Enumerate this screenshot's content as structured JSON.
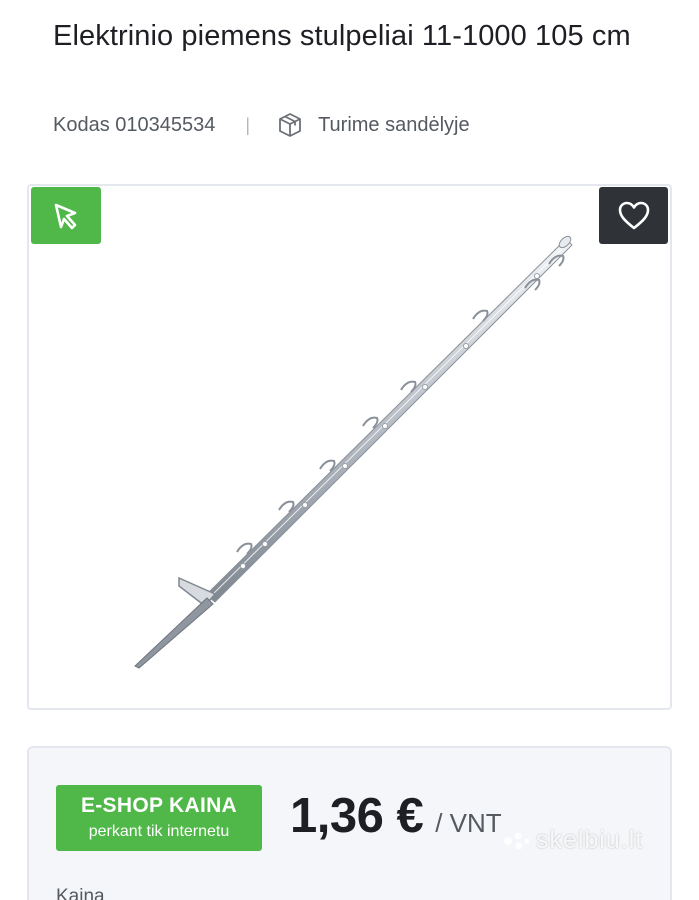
{
  "product": {
    "title": "Elektrinio piemens stulpeliai 11-1000 105 cm",
    "code_label": "Kodas 010345534",
    "separator": "|",
    "stock_status": "Turime sandėlyje"
  },
  "icons": {
    "stock": "box-icon",
    "badge": "cursor-click-icon",
    "favorite": "heart-icon",
    "watermark": "skelbiu-logo-icon"
  },
  "price": {
    "badge_title": "E-SHOP KAINA",
    "badge_subtitle": "perkant tik internetu",
    "amount": "1,36 €",
    "unit": "/ VNT",
    "label": "Kaina"
  },
  "watermark": {
    "text": "skelbiu.lt"
  },
  "colors": {
    "accent_green": "#4fb848",
    "favorite_bg": "#2f3237",
    "price_card_bg": "#f4f6f9"
  }
}
